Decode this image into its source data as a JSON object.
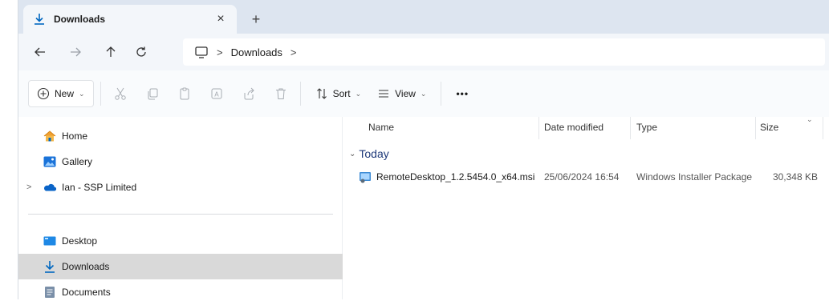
{
  "tab": {
    "title": "Downloads",
    "close": "×",
    "new": "+"
  },
  "address": {
    "crumbs": [
      "Downloads"
    ]
  },
  "commands": {
    "new_label": "New",
    "sort_label": "Sort",
    "view_label": "View",
    "more": "•••"
  },
  "sidebar": {
    "items": [
      {
        "label": "Home",
        "icon": "home-icon"
      },
      {
        "label": "Gallery",
        "icon": "gallery-icon"
      },
      {
        "label": "Ian - SSP Limited",
        "icon": "onedrive-icon"
      },
      {
        "label": "Desktop",
        "icon": "desktop-icon"
      },
      {
        "label": "Downloads",
        "icon": "download-icon"
      },
      {
        "label": "Documents",
        "icon": "documents-icon"
      }
    ]
  },
  "columns": {
    "name": "Name",
    "date": "Date modified",
    "type": "Type",
    "size": "Size"
  },
  "group": {
    "label": "Today"
  },
  "files": [
    {
      "name": "RemoteDesktop_1.2.5454.0_x64.msi",
      "date": "25/06/2024 16:54",
      "type": "Windows Installer Package",
      "size": "30,348 KB"
    }
  ],
  "colors": {
    "accent": "#0067c0",
    "tabstrip": "#dde5f0",
    "selected": "#d9d9d9"
  }
}
